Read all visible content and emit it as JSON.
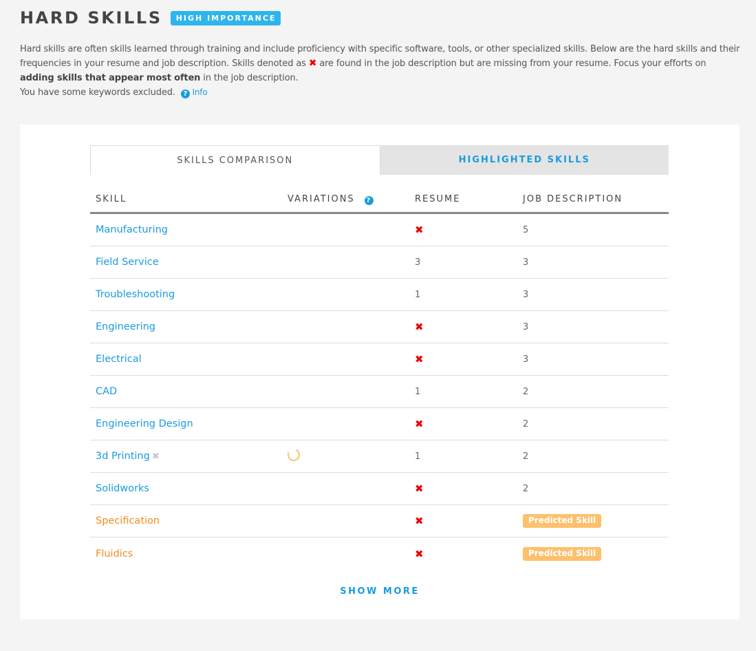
{
  "header": {
    "title": "HARD SKILLS",
    "badge": "HIGH IMPORTANCE"
  },
  "intro": {
    "part1": "Hard skills are often skills learned through training and include proficiency with specific software, tools, or other specialized skills. Below are the hard skills and their frequencies in your resume and job description. Skills denoted as ",
    "missing_icon": "✖",
    "part2": " are found in the job description but are missing from your resume. Focus your efforts on ",
    "bold": "adding skills that appear most often",
    "part3": " in the job description.",
    "excluded_text": "You have some keywords excluded.",
    "info_icon": "?",
    "info_label": "Info"
  },
  "tabs": [
    {
      "label": "SKILLS COMPARISON",
      "active": true
    },
    {
      "label": "HIGHLIGHTED SKILLS",
      "active": false
    }
  ],
  "table": {
    "headers": {
      "skill": "SKILL",
      "variations": "VARIATIONS",
      "variations_help_icon": "?",
      "resume": "RESUME",
      "job": "JOB DESCRIPTION"
    },
    "missing_icon": "✖",
    "remove_icon": "✖",
    "rows": [
      {
        "skill": "Manufacturing",
        "predicted": false,
        "variations": "",
        "resume": "missing",
        "job": "5"
      },
      {
        "skill": "Field Service",
        "predicted": false,
        "variations": "",
        "resume": "3",
        "job": "3"
      },
      {
        "skill": "Troubleshooting",
        "predicted": false,
        "variations": "",
        "resume": "1",
        "job": "3"
      },
      {
        "skill": "Engineering",
        "predicted": false,
        "variations": "",
        "resume": "missing",
        "job": "3"
      },
      {
        "skill": "Electrical",
        "predicted": false,
        "variations": "",
        "resume": "missing",
        "job": "3"
      },
      {
        "skill": "CAD",
        "predicted": false,
        "variations": "",
        "resume": "1",
        "job": "2"
      },
      {
        "skill": "Engineering Design",
        "predicted": false,
        "variations": "",
        "resume": "missing",
        "job": "2"
      },
      {
        "skill": "3d Printing",
        "predicted": false,
        "removable": true,
        "variations": "loading",
        "resume": "1",
        "job": "2"
      },
      {
        "skill": "Solidworks",
        "predicted": false,
        "variations": "",
        "resume": "missing",
        "job": "2"
      },
      {
        "skill": "Specification",
        "predicted": true,
        "variations": "",
        "resume": "missing",
        "job": "Predicted Skill"
      },
      {
        "skill": "Fluidics",
        "predicted": true,
        "variations": "",
        "resume": "missing",
        "job": "Predicted Skill"
      }
    ]
  },
  "show_more": "SHOW MORE",
  "colors": {
    "accent": "#1a9be0",
    "badge": "#2db5ec",
    "missing": "#ee0000",
    "predicted": "#f58a1f",
    "predicted_badge": "#fec06b"
  }
}
